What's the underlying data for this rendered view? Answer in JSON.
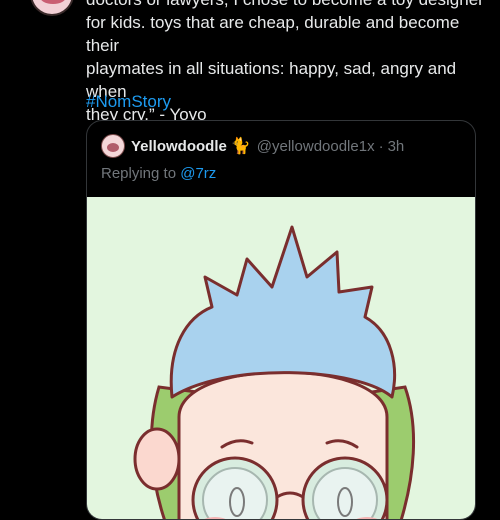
{
  "tweet": {
    "text": "doctors or lawyers, I chose to become a toy designer\nfor kids. toys that are cheap, durable and become their\nplaymates in all situations: happy, sad, angry and when\nthey cry.” - Yoyo",
    "hashtag": "#NomStory"
  },
  "quoted_tweet": {
    "display_name": "Yellowdoodle",
    "name_emoji": "🐈",
    "handle": "@yellowdoodle1x",
    "separator": "·",
    "time": "3h",
    "replying_prefix": "Replying to ",
    "replying_to": "@7rz"
  },
  "colors": {
    "background": "#000000",
    "text": "#e7e9ea",
    "muted": "#71767b",
    "link": "#1d9bf0",
    "image_bg": "#e3f6df",
    "hair": "#a9d2ee",
    "side_hair": "#9ccc6e",
    "face": "#fbe6dc"
  }
}
